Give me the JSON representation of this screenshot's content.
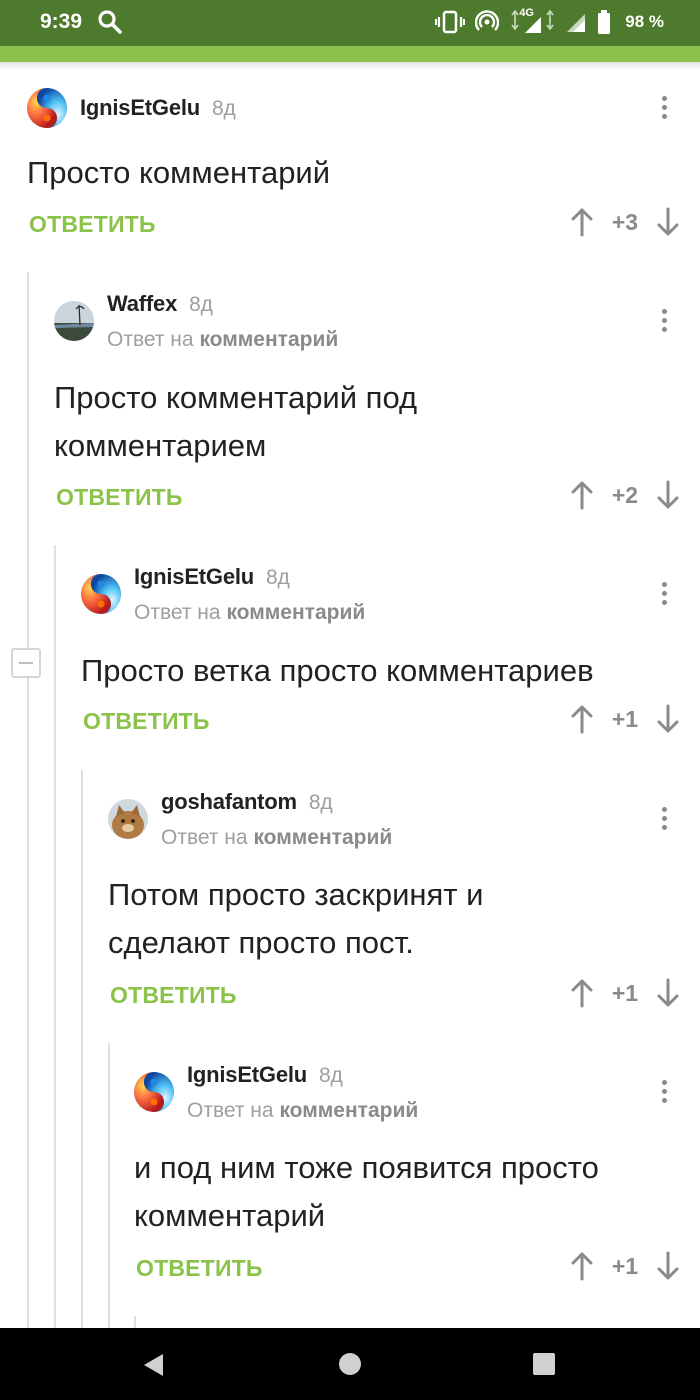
{
  "status_bar": {
    "time": "9:39",
    "network": "4G",
    "battery": "98 %"
  },
  "colors": {
    "status_bar": "#4d7a2d",
    "accent": "#8bc34a",
    "text": "#222222",
    "muted": "#9e9e9e"
  },
  "comments": [
    {
      "user": "IgnisEtGelu",
      "date": "8д",
      "reply_prefix": "",
      "reply_target": "",
      "text": "Просто комментарий",
      "reply_label": "ОТВЕТИТЬ",
      "score": "+3",
      "avatar": "fire-ice-avatar"
    },
    {
      "user": "Waffex",
      "date": "8д",
      "reply_prefix": "Ответ на",
      "reply_target": "комментарий",
      "text": "Просто комментарий под комментарием",
      "reply_label": "ОТВЕТИТЬ",
      "score": "+2",
      "avatar": "landscape-avatar"
    },
    {
      "user": "IgnisEtGelu",
      "date": "8д",
      "reply_prefix": "Ответ на",
      "reply_target": "комментарий",
      "text": "Просто ветка просто комментариев",
      "reply_label": "ОТВЕТИТЬ",
      "score": "+1",
      "avatar": "fire-ice-avatar"
    },
    {
      "user": "goshafantom",
      "date": "8д",
      "reply_prefix": "Ответ на",
      "reply_target": "комментарий",
      "text": "Потом просто заскринят и сделают просто пост.",
      "reply_label": "ОТВЕТИТЬ",
      "score": "+1",
      "avatar": "cat-avatar"
    },
    {
      "user": "IgnisEtGelu",
      "date": "8д",
      "reply_prefix": "Ответ на",
      "reply_target": "комментарий",
      "text": "и под ним тоже появится просто комментарий",
      "reply_label": "ОТВЕТИТЬ",
      "score": "+1",
      "avatar": "fire-ice-avatar"
    }
  ],
  "nav_bar": {
    "icons": [
      "back-icon",
      "home-icon",
      "recents-icon"
    ]
  }
}
